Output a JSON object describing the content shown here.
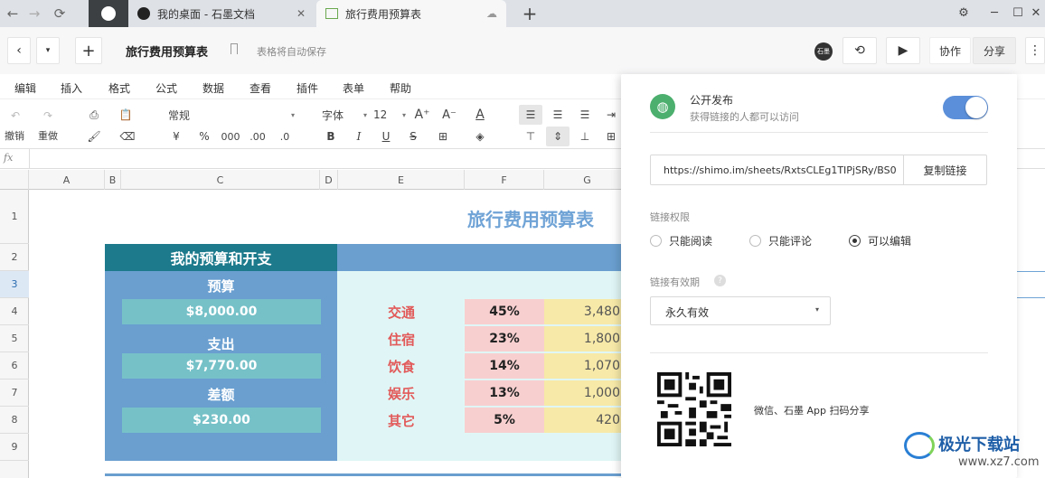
{
  "browser": {
    "tabs": [
      {
        "label": "我的桌面 - 石墨文档"
      },
      {
        "label": "旅行费用预算表"
      }
    ],
    "new_tab": "+"
  },
  "header": {
    "title": "旅行费用预算表",
    "autosave": "表格将自动保存",
    "collaborate": "协作",
    "share": "分享",
    "avatar": "石墨"
  },
  "menu": [
    "编辑",
    "插入",
    "格式",
    "公式",
    "数据",
    "查看",
    "插件",
    "表单",
    "帮助"
  ],
  "toolbar": {
    "undo": "撤销",
    "redo": "重做",
    "format": "常规",
    "currency": "¥",
    "percent": "%",
    "thousands": "000",
    "dec_inc": ".00",
    "dec_dec": ".0",
    "font": "字体",
    "font_size": "12",
    "bold": "B",
    "italic": "I",
    "underline": "U",
    "strike": "S"
  },
  "formula_bar": {
    "fx": "fx",
    "value": ""
  },
  "columns": [
    "A",
    "B",
    "C",
    "D",
    "E",
    "F",
    "G"
  ],
  "rows": [
    "1",
    "2",
    "3",
    "4",
    "5",
    "6",
    "7",
    "8",
    "9"
  ],
  "sheet": {
    "title": "旅行费用预算表",
    "panel_header": "我的预算和开支",
    "budget_label": "预算",
    "budget_value": "$8,000.00",
    "expense_label": "支出",
    "expense_value": "$7,770.00",
    "diff_label": "差额",
    "diff_value": "$230.00",
    "categories": [
      {
        "name": "交通",
        "pct": "45%",
        "amount": "3,480"
      },
      {
        "name": "住宿",
        "pct": "23%",
        "amount": "1,800"
      },
      {
        "name": "饮食",
        "pct": "14%",
        "amount": "1,070"
      },
      {
        "name": "娱乐",
        "pct": "13%",
        "amount": "1,000"
      },
      {
        "name": "其它",
        "pct": "5%",
        "amount": "420"
      }
    ]
  },
  "share": {
    "publish_title": "公开发布",
    "publish_desc": "获得链接的人都可以访问",
    "publish_on": true,
    "link": "https://shimo.im/sheets/RxtsCLEg1TIPjSRy/BS0",
    "copy_link": "复制链接",
    "permission_label": "链接权限",
    "permissions": [
      "只能阅读",
      "只能评论",
      "可以编辑"
    ],
    "permission_selected": "可以编辑",
    "expiry_label": "链接有效期",
    "expiry_value": "永久有效",
    "qr_caption": "微信、石墨 App 扫码分享"
  },
  "watermark": {
    "text": "极光下载站",
    "url": "www.xz7.com"
  },
  "colors": {
    "panel_dark": "#1c7a8c",
    "panel_blue": "#6a9fd0",
    "value_box": "#76c1c8",
    "light_cyan": "#e0f6f6",
    "pct_pink": "#f8cfcf",
    "amount_yellow": "#f7e9a8",
    "category_text": "#e25a5a",
    "title_blue": "#6fa3d6",
    "toggle_blue": "#5b8fd9"
  }
}
